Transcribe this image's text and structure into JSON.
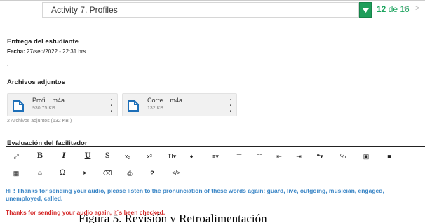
{
  "header": {
    "activity_title": "Activity 7. Profiles",
    "counter_current": "12",
    "counter_of": "de 16",
    "prev_icon": "chevron-left-icon",
    "next_icon": "chevron-right-icon",
    "accent_color": "#1e9e5a"
  },
  "delivery": {
    "title": "Entrega del estudiante",
    "date_label": "Fecha:",
    "date_value": "27/sep/2022 - 22:31 hrs.",
    "extra": "."
  },
  "attachments": {
    "title": "Archivos adjuntos",
    "files": [
      {
        "name": "Profi....m4a",
        "size": "930.75 KB",
        "icon": "file-icon"
      },
      {
        "name": "Corre....m4a",
        "size": "132 KB",
        "icon": "file-icon"
      }
    ],
    "summary": "2 Archivos adjuntos (132 KB )"
  },
  "evaluation": {
    "title": "Evaluación del facilitador"
  },
  "toolbar": {
    "row1": [
      {
        "name": "expand-icon",
        "glyph": "⤢"
      },
      {
        "name": "bold-button",
        "glyph": "B"
      },
      {
        "name": "italic-button",
        "glyph": "I"
      },
      {
        "name": "underline-button",
        "glyph": "U"
      },
      {
        "name": "strikethrough-button",
        "glyph": "S"
      },
      {
        "name": "subscript-button",
        "glyph": "x₂"
      },
      {
        "name": "superscript-button",
        "glyph": "x²"
      },
      {
        "name": "font-size-button",
        "glyph": "TI▾"
      },
      {
        "name": "color-fill-icon",
        "glyph": "♦"
      },
      {
        "name": "align-button",
        "glyph": "≡▾"
      },
      {
        "name": "ordered-list-button",
        "glyph": "☰"
      },
      {
        "name": "unordered-list-button",
        "glyph": "☷"
      },
      {
        "name": "outdent-button",
        "glyph": "⇤"
      },
      {
        "name": "indent-button",
        "glyph": "⇥"
      },
      {
        "name": "quote-button",
        "glyph": "❝▾"
      },
      {
        "name": "link-button",
        "glyph": "%"
      },
      {
        "name": "image-button",
        "glyph": "▣"
      },
      {
        "name": "video-button",
        "glyph": "■"
      }
    ],
    "row2": [
      {
        "name": "table-button",
        "glyph": "▦"
      },
      {
        "name": "emoticon-button",
        "glyph": "☺"
      },
      {
        "name": "special-char-button",
        "glyph": "Ω"
      },
      {
        "name": "select-cursor-icon",
        "glyph": "➤"
      },
      {
        "name": "eraser-button",
        "glyph": "⌫"
      },
      {
        "name": "print-button",
        "glyph": "⎙"
      },
      {
        "name": "help-button",
        "glyph": "?"
      },
      {
        "name": "code-view-button",
        "glyph": "</>"
      }
    ]
  },
  "content": {
    "message1": "Hi ! Thanks for sending your audio, please listen to the pronunciation of these words again: guard, live, outgoing, musician, engaged, unemployed, called.",
    "message1_color": "#3b86c6",
    "message2": "Thanks for sending your audio again, it´s been checked.",
    "message2_color": "#d42a2a"
  },
  "caption": "Figura 5. Revisión y Retroalimentación"
}
